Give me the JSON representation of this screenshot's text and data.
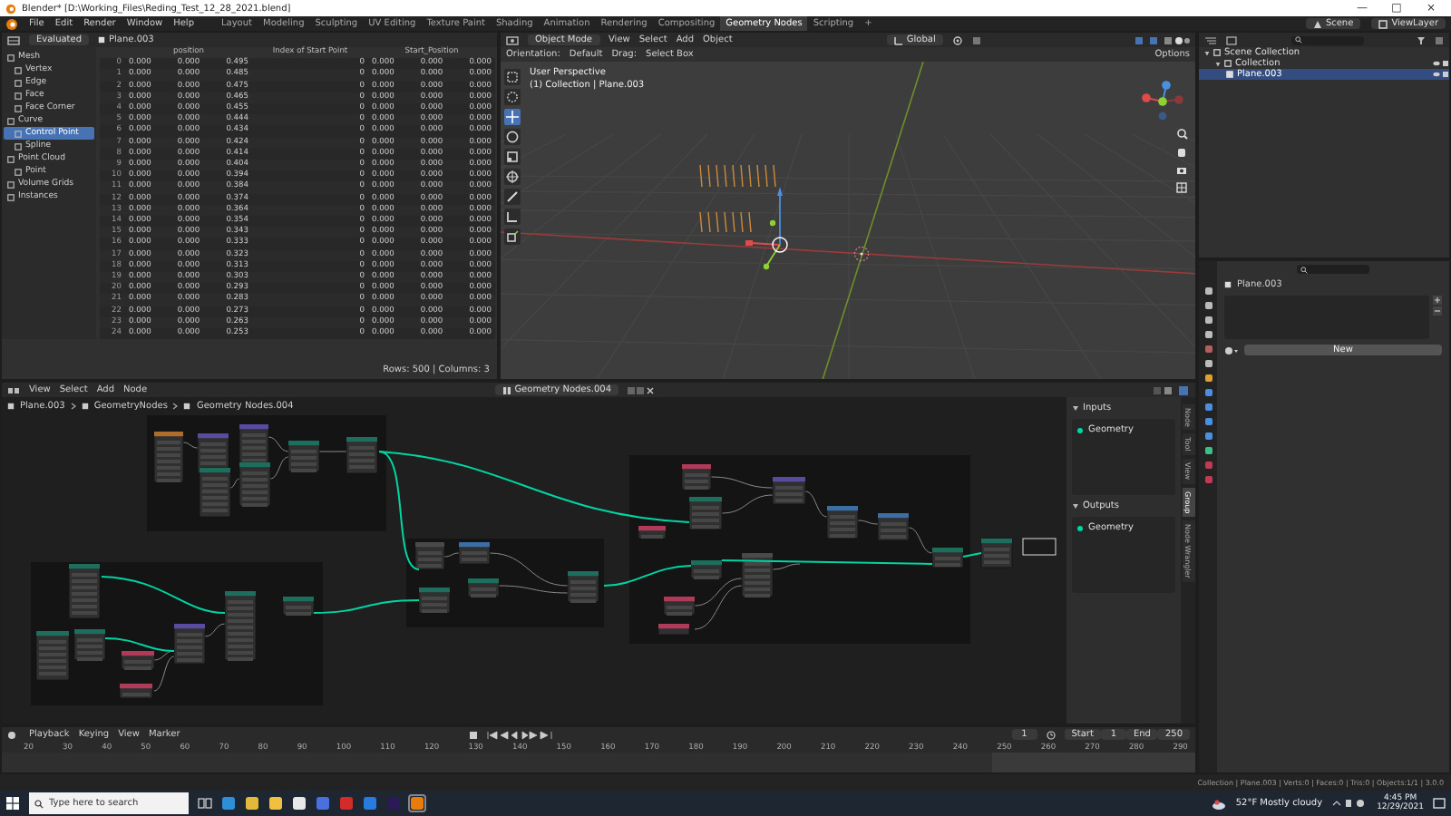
{
  "window": {
    "title": "Blender* [D:\\Working_Files\\Reding_Test_12_28_2021.blend]",
    "controls": [
      "—",
      "□",
      "×"
    ]
  },
  "menu": [
    "File",
    "Edit",
    "Render",
    "Window",
    "Help"
  ],
  "workspaces": [
    {
      "label": "Layout",
      "selected": false
    },
    {
      "label": "Modeling",
      "selected": false
    },
    {
      "label": "Sculpting",
      "selected": false
    },
    {
      "label": "UV Editing",
      "selected": false
    },
    {
      "label": "Texture Paint",
      "selected": false
    },
    {
      "label": "Shading",
      "selected": false
    },
    {
      "label": "Animation",
      "selected": false
    },
    {
      "label": "Rendering",
      "selected": false
    },
    {
      "label": "Compositing",
      "selected": false
    },
    {
      "label": "Geometry Nodes",
      "selected": true
    },
    {
      "label": "Scripting",
      "selected": false
    }
  ],
  "workspace_add": "+",
  "scene": "Scene",
  "view_layer": "ViewLayer",
  "spreadsheet": {
    "mode": "Evaluated",
    "object": "Plane.003",
    "sidebar": [
      {
        "label": "Mesh",
        "selected": false,
        "children": [
          {
            "label": "Vertex",
            "selected": false
          },
          {
            "label": "Edge",
            "selected": false
          },
          {
            "label": "Face",
            "selected": false
          },
          {
            "label": "Face Corner",
            "selected": false
          }
        ]
      },
      {
        "label": "Curve",
        "selected": false,
        "children": [
          {
            "label": "Control Point",
            "selected": true
          },
          {
            "label": "Spline",
            "selected": false
          }
        ]
      },
      {
        "label": "Point Cloud",
        "selected": false,
        "children": [
          {
            "label": "Point",
            "selected": false
          }
        ]
      },
      {
        "label": "Volume Grids",
        "selected": false
      },
      {
        "label": "Instances",
        "selected": false
      }
    ],
    "columns": [
      {
        "label": "position",
        "kind": "vector"
      },
      {
        "label": "Index of Start Point",
        "kind": "int"
      },
      {
        "label": "Start_Position",
        "kind": "vector"
      }
    ],
    "rows": [
      {
        "index": "0",
        "cells": [
          [
            "0.000",
            "0.000",
            "0.495"
          ],
          "0",
          [
            "0.000",
            "0.000",
            "0.000"
          ]
        ]
      },
      {
        "index": "1",
        "cells": [
          [
            "0.000",
            "0.000",
            "0.485"
          ],
          "0",
          [
            "0.000",
            "0.000",
            "0.000"
          ]
        ]
      },
      {
        "index": "2",
        "cells": [
          [
            "0.000",
            "0.000",
            "0.475"
          ],
          "0",
          [
            "0.000",
            "0.000",
            "0.000"
          ]
        ]
      },
      {
        "index": "3",
        "cells": [
          [
            "0.000",
            "0.000",
            "0.465"
          ],
          "0",
          [
            "0.000",
            "0.000",
            "0.000"
          ]
        ]
      },
      {
        "index": "4",
        "cells": [
          [
            "0.000",
            "0.000",
            "0.455"
          ],
          "0",
          [
            "0.000",
            "0.000",
            "0.000"
          ]
        ]
      },
      {
        "index": "5",
        "cells": [
          [
            "0.000",
            "0.000",
            "0.444"
          ],
          "0",
          [
            "0.000",
            "0.000",
            "0.000"
          ]
        ]
      },
      {
        "index": "6",
        "cells": [
          [
            "0.000",
            "0.000",
            "0.434"
          ],
          "0",
          [
            "0.000",
            "0.000",
            "0.000"
          ]
        ]
      },
      {
        "index": "7",
        "cells": [
          [
            "0.000",
            "0.000",
            "0.424"
          ],
          "0",
          [
            "0.000",
            "0.000",
            "0.000"
          ]
        ]
      },
      {
        "index": "8",
        "cells": [
          [
            "0.000",
            "0.000",
            "0.414"
          ],
          "0",
          [
            "0.000",
            "0.000",
            "0.000"
          ]
        ]
      },
      {
        "index": "9",
        "cells": [
          [
            "0.000",
            "0.000",
            "0.404"
          ],
          "0",
          [
            "0.000",
            "0.000",
            "0.000"
          ]
        ]
      },
      {
        "index": "10",
        "cells": [
          [
            "0.000",
            "0.000",
            "0.394"
          ],
          "0",
          [
            "0.000",
            "0.000",
            "0.000"
          ]
        ]
      },
      {
        "index": "11",
        "cells": [
          [
            "0.000",
            "0.000",
            "0.384"
          ],
          "0",
          [
            "0.000",
            "0.000",
            "0.000"
          ]
        ]
      },
      {
        "index": "12",
        "cells": [
          [
            "0.000",
            "0.000",
            "0.374"
          ],
          "0",
          [
            "0.000",
            "0.000",
            "0.000"
          ]
        ]
      },
      {
        "index": "13",
        "cells": [
          [
            "0.000",
            "0.000",
            "0.364"
          ],
          "0",
          [
            "0.000",
            "0.000",
            "0.000"
          ]
        ]
      },
      {
        "index": "14",
        "cells": [
          [
            "0.000",
            "0.000",
            "0.354"
          ],
          "0",
          [
            "0.000",
            "0.000",
            "0.000"
          ]
        ]
      },
      {
        "index": "15",
        "cells": [
          [
            "0.000",
            "0.000",
            "0.343"
          ],
          "0",
          [
            "0.000",
            "0.000",
            "0.000"
          ]
        ]
      },
      {
        "index": "16",
        "cells": [
          [
            "0.000",
            "0.000",
            "0.333"
          ],
          "0",
          [
            "0.000",
            "0.000",
            "0.000"
          ]
        ]
      },
      {
        "index": "17",
        "cells": [
          [
            "0.000",
            "0.000",
            "0.323"
          ],
          "0",
          [
            "0.000",
            "0.000",
            "0.000"
          ]
        ]
      },
      {
        "index": "18",
        "cells": [
          [
            "0.000",
            "0.000",
            "0.313"
          ],
          "0",
          [
            "0.000",
            "0.000",
            "0.000"
          ]
        ]
      },
      {
        "index": "19",
        "cells": [
          [
            "0.000",
            "0.000",
            "0.303"
          ],
          "0",
          [
            "0.000",
            "0.000",
            "0.000"
          ]
        ]
      },
      {
        "index": "20",
        "cells": [
          [
            "0.000",
            "0.000",
            "0.293"
          ],
          "0",
          [
            "0.000",
            "0.000",
            "0.000"
          ]
        ]
      },
      {
        "index": "21",
        "cells": [
          [
            "0.000",
            "0.000",
            "0.283"
          ],
          "0",
          [
            "0.000",
            "0.000",
            "0.000"
          ]
        ]
      },
      {
        "index": "22",
        "cells": [
          [
            "0.000",
            "0.000",
            "0.273"
          ],
          "0",
          [
            "0.000",
            "0.000",
            "0.000"
          ]
        ]
      },
      {
        "index": "23",
        "cells": [
          [
            "0.000",
            "0.000",
            "0.263"
          ],
          "0",
          [
            "0.000",
            "0.000",
            "0.000"
          ]
        ]
      },
      {
        "index": "24",
        "cells": [
          [
            "0.000",
            "0.000",
            "0.253"
          ],
          "0",
          [
            "0.000",
            "0.000",
            "0.000"
          ]
        ]
      }
    ],
    "footer": "Rows: 500 | Columns: 3"
  },
  "viewport": {
    "mode": "Object Mode",
    "menu": [
      "View",
      "Select",
      "Add",
      "Object"
    ],
    "transform": "Global",
    "options": "Options",
    "tool_row": [
      "Orientation:",
      "Default",
      "Drag:",
      "Select Box"
    ],
    "overlay": [
      "User Perspective",
      "(1) Collection | Plane.003"
    ]
  },
  "outliner": {
    "items": [
      {
        "label": "Scene Collection",
        "selected": false,
        "children": [
          {
            "label": "Collection",
            "selected": false,
            "children": [
              {
                "label": "Plane.003",
                "selected": true
              }
            ]
          }
        ]
      }
    ]
  },
  "properties": {
    "object": "Plane.003",
    "button": "New"
  },
  "node_editor": {
    "menu": [
      "View",
      "Select",
      "Add",
      "Node"
    ],
    "tree": "Geometry Nodes.004",
    "breadcrumb": [
      "Plane.003",
      "GeometryNodes",
      "Geometry Nodes.004"
    ],
    "panels": [
      {
        "title": "Inputs",
        "sockets": [
          "Geometry"
        ]
      },
      {
        "title": "Outputs",
        "sockets": [
          "Geometry"
        ]
      }
    ],
    "side_tabs": [
      {
        "label": "Node",
        "selected": false
      },
      {
        "label": "Tool",
        "selected": false
      },
      {
        "label": "View",
        "selected": false
      },
      {
        "label": "Group",
        "selected": true
      },
      {
        "label": "Node Wrangler",
        "selected": false
      }
    ]
  },
  "timeline": {
    "menu": [
      "Playback",
      "Keying",
      "View",
      "Marker"
    ],
    "current_frame": "1",
    "start_label": "Start",
    "start": "1",
    "end_label": "End",
    "end": "250",
    "ticks": [
      "20",
      "30",
      "40",
      "50",
      "60",
      "70",
      "80",
      "90",
      "100",
      "110",
      "120",
      "130",
      "140",
      "150",
      "160",
      "170",
      "180",
      "190",
      "200",
      "210",
      "220",
      "230",
      "240",
      "250",
      "260",
      "270",
      "280",
      "290"
    ]
  },
  "status_bar": "Collection | Plane.003 | Verts:0 | Faces:0 | Tris:0 | Objects:1/1 | 3.0.0",
  "taskbar": {
    "search": {
      "placeholder": "Type here to search"
    },
    "weather": "52°F  Mostly cloudy",
    "time": "4:45 PM",
    "date": "12/29/2021"
  }
}
